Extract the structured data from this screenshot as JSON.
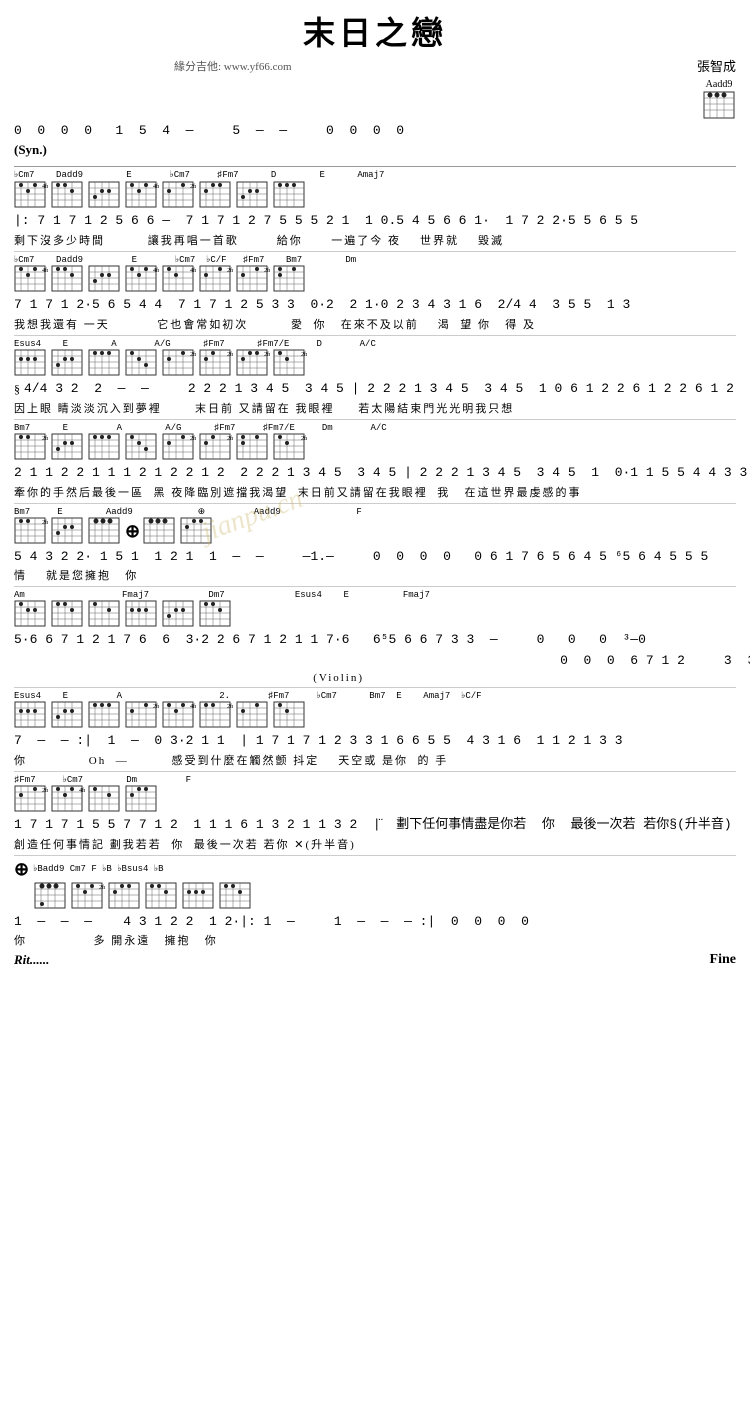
{
  "title": "末日之戀",
  "composer": "張智成",
  "source": "緣分吉他: www.yf66.com",
  "watermark": "jianpu.cn",
  "sections": [
    {
      "id": "intro",
      "label": "(Syn.)",
      "notes": "0  0  0  0   1  5  4  —     5  —  —     0  0  0  0"
    }
  ],
  "fine_label": "Fine",
  "rit_label": "Rit......"
}
